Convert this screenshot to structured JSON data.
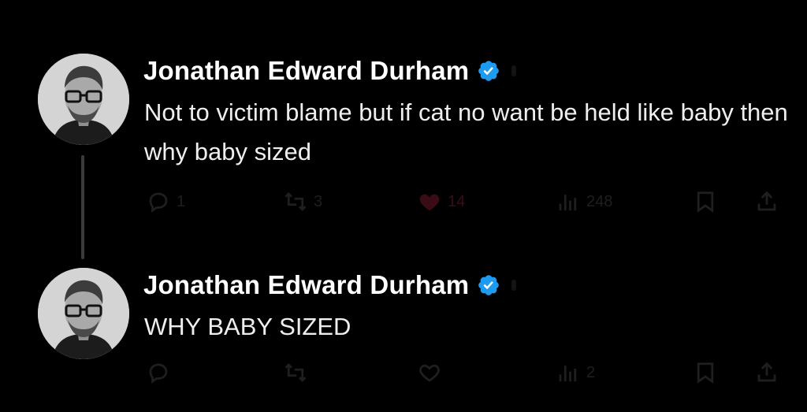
{
  "colors": {
    "background": "#000000",
    "name": "#ffffff",
    "text": "#eeeeee",
    "verified": "#1d9bf0",
    "action_dim": "#1f1f1f",
    "like_dim": "#3a0d16",
    "connector": "#3a3a3a"
  },
  "tweets": [
    {
      "author": "Jonathan Edward Durham",
      "verified_icon": "verified-badge-icon",
      "text": "Not to victim blame but if cat no want be held like baby then why baby sized",
      "actions": {
        "reply_count": "1",
        "repost_count": "3",
        "like_count": "14",
        "like_state": "liked",
        "views_count": "248"
      }
    },
    {
      "author": "Jonathan Edward Durham",
      "verified_icon": "verified-badge-icon",
      "text": "WHY BABY SIZED",
      "actions": {
        "reply_count": "",
        "repost_count": "",
        "like_count": "",
        "like_state": "not-liked",
        "views_count": "2"
      }
    }
  ]
}
